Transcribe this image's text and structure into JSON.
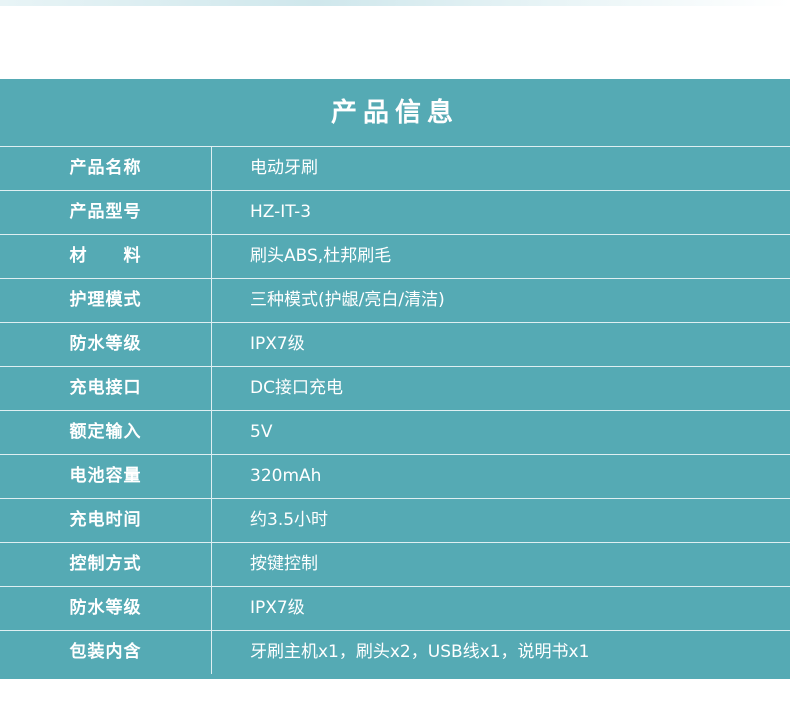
{
  "title": "产品信息",
  "rows": [
    {
      "label": "产品名称",
      "value": "电动牙刷"
    },
    {
      "label": "产品型号",
      "value": "HZ-IT-3"
    },
    {
      "label": "材　　料",
      "value": "刷头ABS,杜邦刷毛"
    },
    {
      "label": "护理模式",
      "value": "三种模式(护龈/亮白/清洁)"
    },
    {
      "label": "防水等级",
      "value": "IPX7级"
    },
    {
      "label": "充电接口",
      "value": "DC接口充电"
    },
    {
      "label": "额定输入",
      "value": "5V"
    },
    {
      "label": "电池容量",
      "value": "320mAh"
    },
    {
      "label": "充电时间",
      "value": "约3.5小时"
    },
    {
      "label": "控制方式",
      "value": "按键控制"
    },
    {
      "label": "防水等级",
      "value": "IPX7级"
    },
    {
      "label": "包装内含",
      "value": "牙刷主机x1，刷头x2，USB线x1，说明书x1"
    }
  ],
  "colors": {
    "panel": "#55aab4",
    "divider": "#dfeff2",
    "text": "#ffffff"
  }
}
